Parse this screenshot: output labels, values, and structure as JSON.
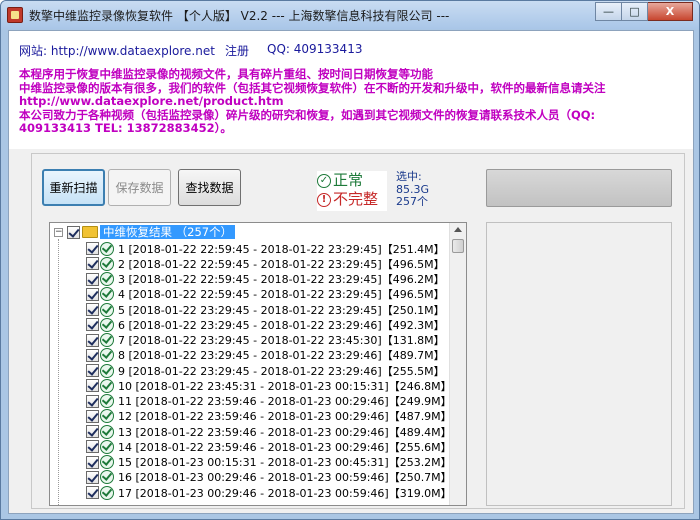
{
  "window": {
    "title": "数擎中维监控录像恢复软件 【个人版】 V2.2 --- 上海数擎信息科技有限公司 ---",
    "min_label": "—",
    "max_label": "□",
    "close_label": "X"
  },
  "header": {
    "website_label": "网站: http://www.dataexplore.net",
    "register_label": "注册",
    "qq_label": "QQ: 409133413",
    "description": [
      "本程序用于恢复中维监控录像的视频文件，具有碎片重组、按时间日期恢复等功能",
      "中维监控录像的版本有很多，我们的软件（包括其它视频恢复软件）在不断的开发和升级中，软件的最新信息请关注",
      "http://www.dataexplore.net/product.htm",
      "本公司致力于各种视频（包括监控录像）碎片级的研究和恢复，如遇到其它视频文件的恢复请联系技术人员（QQ:",
      "409133413  TEL: 13872883452）。"
    ]
  },
  "toolbar": {
    "rescan_label": "重新扫描",
    "save_label": "保存数据",
    "find_label": "查找数据"
  },
  "status": {
    "normal_label": "正常",
    "incomplete_label": "不完整",
    "normal_color": "#1e7a3a",
    "incomplete_color": "#c62828"
  },
  "selection": {
    "title": "选中:",
    "size": "85.3G",
    "count": "257个"
  },
  "tree": {
    "root_label": "中维恢复结果 （257个）",
    "items": [
      "1 [2018-01-22 22:59:45 - 2018-01-22 23:29:45]【251.4M】",
      "2 [2018-01-22 22:59:45 - 2018-01-22 23:29:45]【496.5M】",
      "3 [2018-01-22 22:59:45 - 2018-01-22 23:29:45]【496.2M】",
      "4 [2018-01-22 22:59:45 - 2018-01-22 23:29:45]【496.5M】",
      "5 [2018-01-22 23:29:45 - 2018-01-22 23:29:45]【250.1M】",
      "6 [2018-01-22 23:29:45 - 2018-01-22 23:29:46]【492.3M】",
      "7 [2018-01-22 23:29:45 - 2018-01-22 23:45:30]【131.8M】",
      "8 [2018-01-22 23:29:45 - 2018-01-22 23:29:46]【489.7M】",
      "9 [2018-01-22 23:29:45 - 2018-01-22 23:29:46]【255.5M】",
      "10 [2018-01-22 23:45:31 - 2018-01-23 00:15:31]【246.8M】",
      "11 [2018-01-22 23:59:46 - 2018-01-23 00:29:46]【249.9M】",
      "12 [2018-01-22 23:59:46 - 2018-01-23 00:29:46]【487.9M】",
      "13 [2018-01-22 23:59:46 - 2018-01-23 00:29:46]【489.4M】",
      "14 [2018-01-22 23:59:46 - 2018-01-23 00:29:46]【255.6M】",
      "15 [2018-01-23 00:15:31 - 2018-01-23 00:45:31]【253.2M】",
      "16 [2018-01-23 00:29:46 - 2018-01-23 00:59:46]【250.7M】",
      "17 [2018-01-23 00:29:46 - 2018-01-23 00:59:46]【319.0M】"
    ]
  }
}
